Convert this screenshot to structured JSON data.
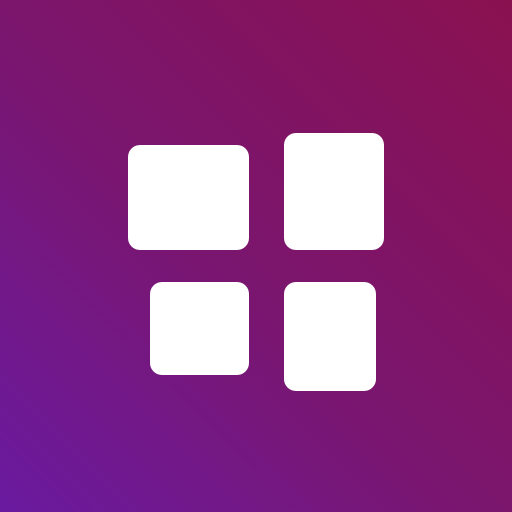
{
  "icon": {
    "name": "app-grid-icon",
    "background_start": "#6a1aa0",
    "background_end": "#8a1150",
    "tile_color": "#ffffff",
    "tile_count": 4
  }
}
